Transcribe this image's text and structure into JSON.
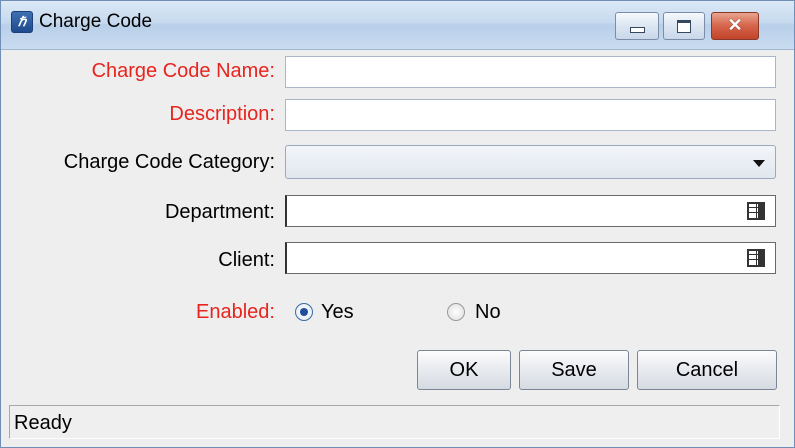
{
  "window": {
    "title": "Charge Code",
    "app_icon": "hp-logo-icon"
  },
  "title_buttons": {
    "minimize": "minimize-icon",
    "maximize": "maximize-icon",
    "close": "close-icon"
  },
  "form": {
    "charge_code_name": {
      "label": "Charge Code Name:",
      "value": "",
      "required": true
    },
    "description": {
      "label": "Description:",
      "value": "",
      "required": true
    },
    "category": {
      "label": "Charge Code Category:",
      "selected": ""
    },
    "department": {
      "label": "Department:",
      "value": ""
    },
    "client": {
      "label": "Client:",
      "value": ""
    },
    "enabled": {
      "label": "Enabled:",
      "required": true,
      "options": [
        "Yes",
        "No"
      ],
      "selected": "Yes"
    }
  },
  "buttons": {
    "ok": "OK",
    "save": "Save",
    "cancel": "Cancel"
  },
  "status": "Ready",
  "colors": {
    "required_label": "#e8241e",
    "title_bar": "#c6d9ee",
    "dialog_bg": "#eeeeee"
  }
}
